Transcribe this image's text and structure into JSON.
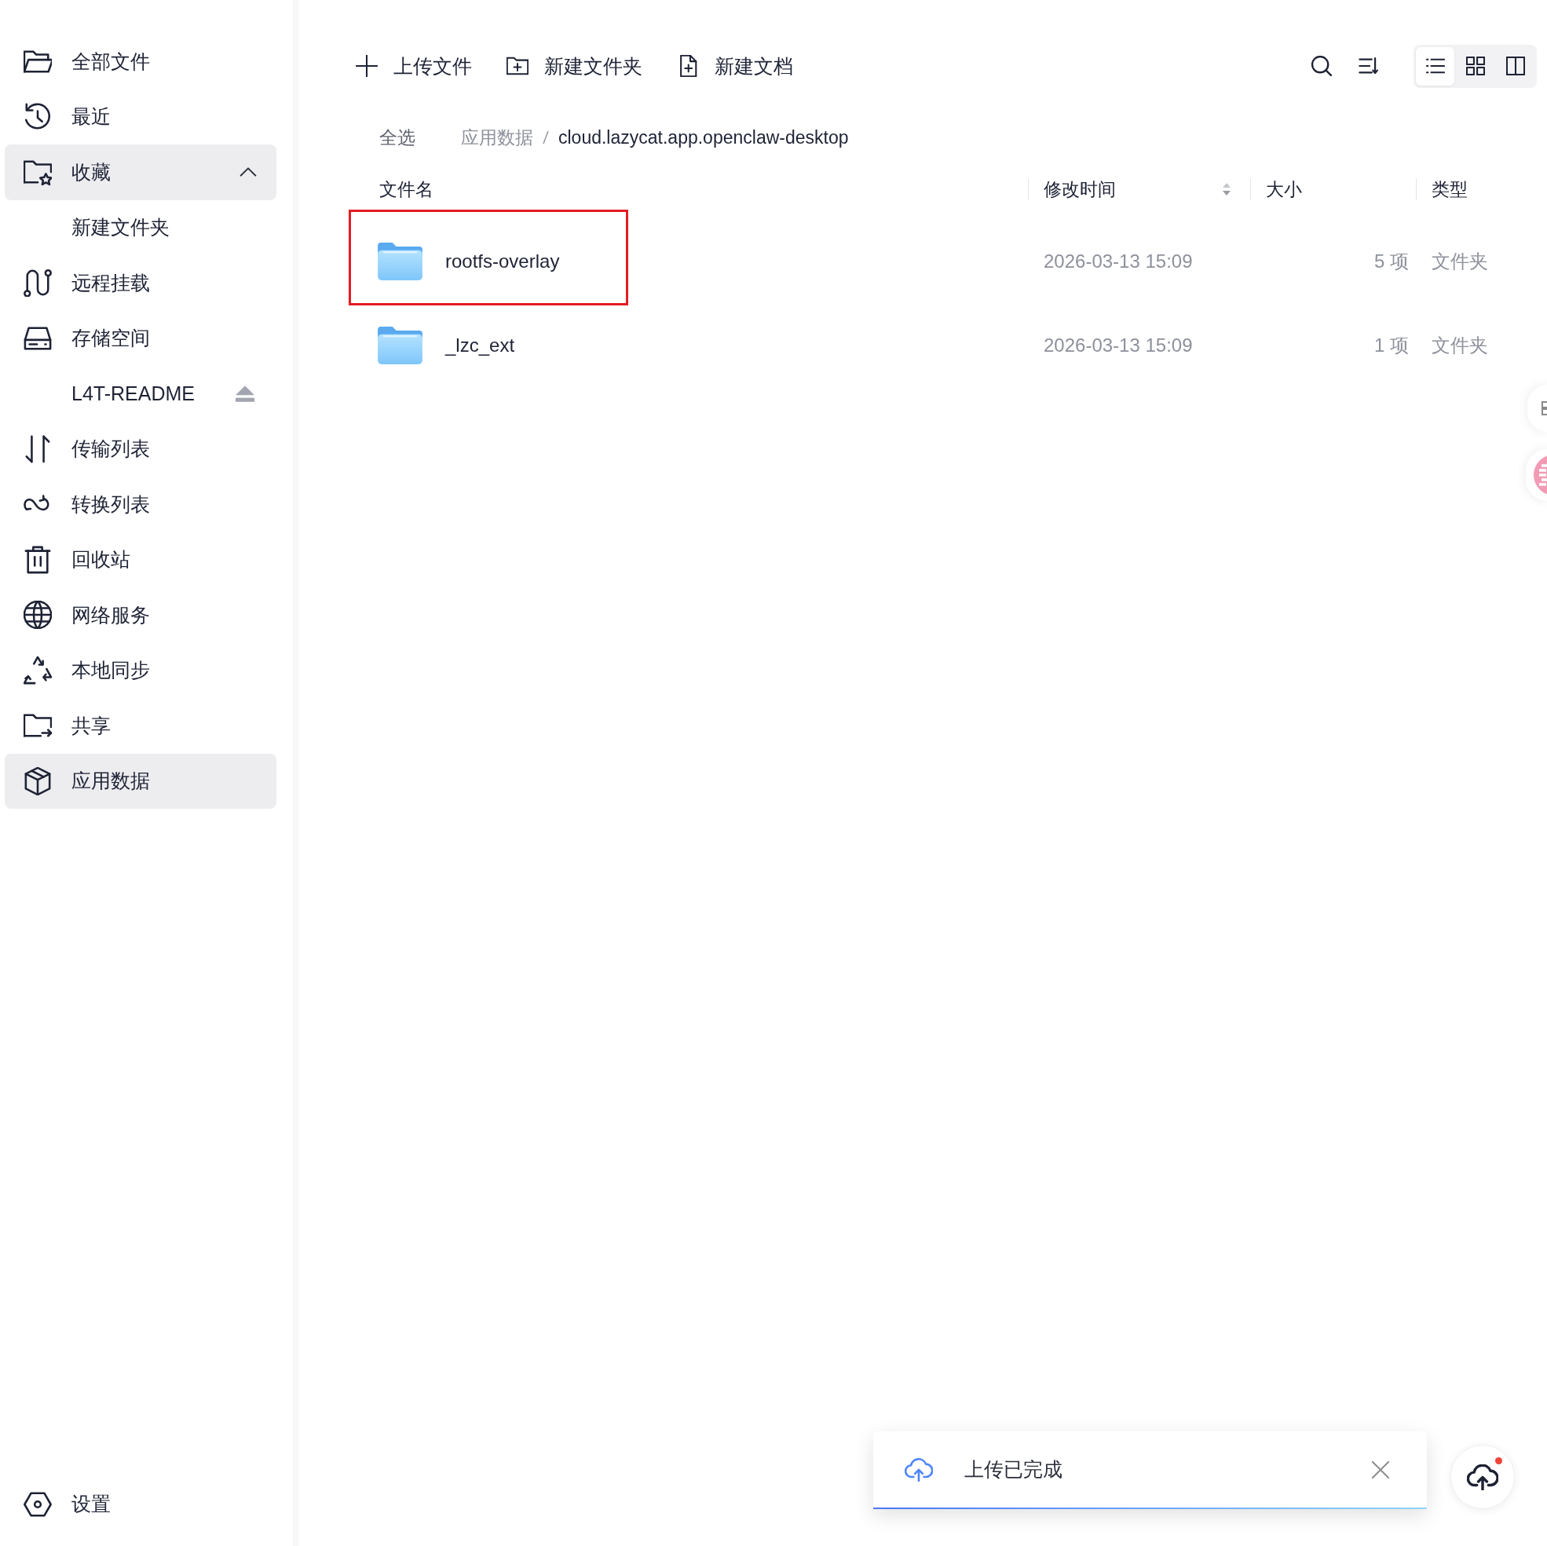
{
  "sidebar": {
    "items": [
      {
        "label": "全部文件",
        "selected": false
      },
      {
        "label": "最近",
        "selected": false
      },
      {
        "label": "收藏",
        "selected": true,
        "expanded": true,
        "children": [
          {
            "label": "新建文件夹",
            "selected": false
          }
        ]
      },
      {
        "label": "远程挂载",
        "selected": false
      },
      {
        "label": "存储空间",
        "selected": false,
        "children": [
          {
            "label": "L4T-README",
            "selected": false,
            "ejectable": true
          }
        ]
      },
      {
        "label": "传输列表",
        "selected": false
      },
      {
        "label": "转换列表",
        "selected": false
      },
      {
        "label": "回收站",
        "selected": false
      },
      {
        "label": "网络服务",
        "selected": false
      },
      {
        "label": "本地同步",
        "selected": false
      },
      {
        "label": "共享",
        "selected": false
      },
      {
        "label": "应用数据",
        "selected": true
      }
    ],
    "footer": {
      "label": "设置"
    }
  },
  "toolbar": {
    "actions": [
      {
        "label": "上传文件"
      },
      {
        "label": "新建文件夹"
      },
      {
        "label": "新建文档"
      }
    ],
    "view_modes": [
      {
        "selected": true
      },
      {
        "selected": false
      },
      {
        "selected": false
      }
    ]
  },
  "breadcrumb": {
    "select_all": "全选",
    "path": [
      "应用数据",
      "cloud.lazycat.app.openclaw-desktop"
    ]
  },
  "table": {
    "columns": [
      {
        "label": "文件名",
        "sortable": false
      },
      {
        "label": "修改时间",
        "sortable": true
      },
      {
        "label": "大小",
        "sortable": false
      },
      {
        "label": "类型",
        "sortable": false
      }
    ],
    "rows": [
      {
        "name": "rootfs-overlay",
        "modified": "2026-03-13 15:09",
        "size": "5 项",
        "type": "文件夹",
        "highlighted": true
      },
      {
        "name": "_lzc_ext",
        "modified": "2026-03-13 15:09",
        "size": "1 项",
        "type": "文件夹",
        "highlighted": false
      }
    ]
  },
  "toast": {
    "message": "上传已完成"
  },
  "upload_button": {
    "notification": true
  }
}
